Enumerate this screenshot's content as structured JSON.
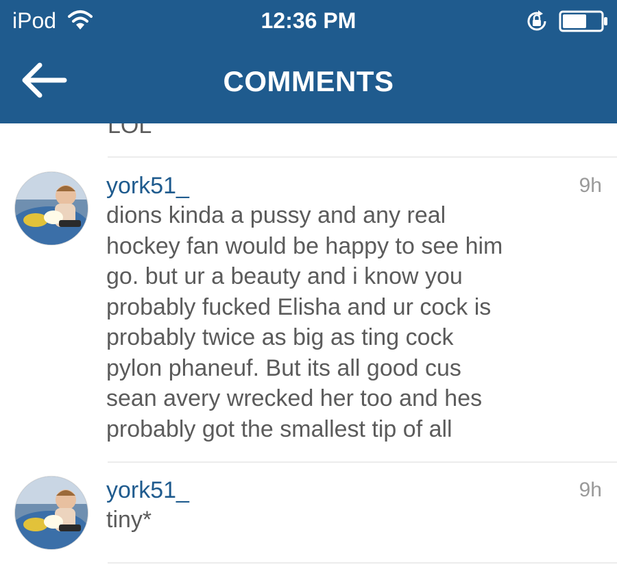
{
  "status_bar": {
    "carrier": "iPod",
    "time": "12:36 PM",
    "wifi_icon": "wifi-icon",
    "rotation_lock_icon": "rotation-lock-icon",
    "battery_icon": "battery-icon"
  },
  "nav": {
    "back_icon": "arrow-left-icon",
    "title": "COMMENTS"
  },
  "previous_comment_tail": "LOL",
  "comments": [
    {
      "username": "york51_",
      "time": "9h",
      "text": "dions kinda a pussy and any real\nhockey fan would be happy to see him\ngo. but ur a beauty and i know you\nprobably fucked Elisha and ur cock is\nprobably twice as big as ting cock\npylon phaneuf. But its all good cus\nsean avery wrecked her too and hes\nprobably got the smallest tip of all"
    },
    {
      "username": "york51_",
      "time": "9h",
      "text": "tiny*"
    }
  ],
  "colors": {
    "header_bg": "#1f5b8e",
    "username": "#1f5b8e",
    "body_text": "#5b5b5b",
    "timestamp": "#9a9a9a"
  }
}
